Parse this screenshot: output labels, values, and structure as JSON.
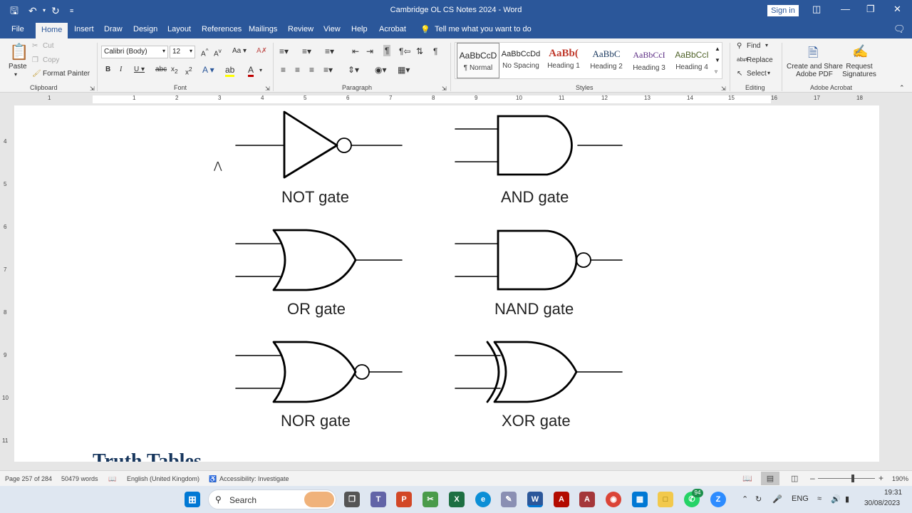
{
  "titlebar": {
    "title": "Cambridge OL CS Notes 2024  -  Word",
    "sign_in": "Sign in"
  },
  "tabs": [
    "File",
    "Home",
    "Insert",
    "Draw",
    "Design",
    "Layout",
    "References",
    "Mailings",
    "Review",
    "View",
    "Help",
    "Acrobat"
  ],
  "tell_me": "Tell me what you want to do",
  "clipboard": {
    "paste": "Paste",
    "cut": "Cut",
    "copy": "Copy",
    "format_painter": "Format Painter",
    "label": "Clipboard"
  },
  "font": {
    "name": "Calibri (Body)",
    "size": "12",
    "label": "Font"
  },
  "paragraph": {
    "label": "Paragraph"
  },
  "styles": {
    "label": "Styles",
    "items": [
      {
        "preview": "AaBbCcD",
        "name": "¶ Normal"
      },
      {
        "preview": "AaBbCcDd",
        "name": "No Spacing"
      },
      {
        "preview": "AaBb(",
        "name": "Heading 1"
      },
      {
        "preview": "AaBbC",
        "name": "Heading 2"
      },
      {
        "preview": "AaBbCcI",
        "name": "Heading 3"
      },
      {
        "preview": "AaBbCcI",
        "name": "Heading 4"
      }
    ]
  },
  "editing": {
    "find": "Find",
    "replace": "Replace",
    "select": "Select",
    "label": "Editing"
  },
  "acrobat": {
    "create_share": "Create and Share",
    "adobe_pdf": "Adobe PDF",
    "request": "Request",
    "signatures": "Signatures",
    "label": "Adobe Acrobat"
  },
  "ruler": [
    "1",
    "1",
    "2",
    "3",
    "4",
    "5",
    "6",
    "7",
    "8",
    "9",
    "10",
    "11",
    "12",
    "13",
    "14",
    "15",
    "16",
    "17",
    "18"
  ],
  "vruler": [
    "4",
    "5",
    "6",
    "7",
    "8",
    "9",
    "10",
    "11"
  ],
  "document": {
    "gates": [
      "NOT gate",
      "AND gate",
      "OR gate",
      "NAND gate",
      "NOR gate",
      "XOR gate"
    ],
    "heading": "Truth Tables"
  },
  "status": {
    "page": "Page 257 of 284",
    "words": "50479 words",
    "language": "English (United Kingdom)",
    "accessibility": "Accessibility: Investigate",
    "zoom": "190%"
  },
  "taskbar": {
    "search": "Search",
    "whatsapp_badge": "94",
    "lang": "ENG",
    "time": "19:31",
    "date": "30/08/2023"
  },
  "colors": {
    "word_blue": "#2b579a",
    "heading_navy": "#17365d"
  }
}
